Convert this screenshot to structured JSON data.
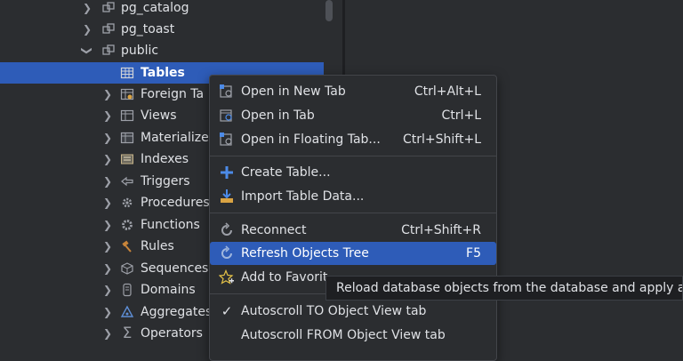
{
  "tree": {
    "items": [
      {
        "label": "pg_catalog",
        "icon": "schema-icon",
        "expanded": false
      },
      {
        "label": "pg_toast",
        "icon": "schema-icon",
        "expanded": false
      },
      {
        "label": "public",
        "icon": "schema-icon",
        "expanded": true
      },
      {
        "label": "Tables",
        "icon": "table-icon",
        "selected": true
      },
      {
        "label": "Foreign Ta",
        "icon": "foreign-table-icon"
      },
      {
        "label": "Views",
        "icon": "view-icon"
      },
      {
        "label": "Materialize",
        "icon": "materialized-view-icon"
      },
      {
        "label": "Indexes",
        "icon": "index-icon"
      },
      {
        "label": "Triggers",
        "icon": "trigger-icon"
      },
      {
        "label": "Procedures",
        "icon": "procedure-icon"
      },
      {
        "label": "Functions",
        "icon": "function-icon"
      },
      {
        "label": "Rules",
        "icon": "rule-icon"
      },
      {
        "label": "Sequences",
        "icon": "sequence-icon"
      },
      {
        "label": "Domains",
        "icon": "domain-icon"
      },
      {
        "label": "Aggregates",
        "icon": "aggregate-icon"
      },
      {
        "label": "Operators",
        "icon": "operator-icon"
      }
    ]
  },
  "menu": {
    "items": [
      {
        "label": "Open in New Tab",
        "shortcut": "Ctrl+Alt+L",
        "icon": "open-new-tab-icon"
      },
      {
        "label": "Open in Tab",
        "shortcut": "Ctrl+L",
        "icon": "open-tab-icon"
      },
      {
        "label": "Open in Floating Tab...",
        "shortcut": "Ctrl+Shift+L",
        "icon": "open-floating-tab-icon"
      },
      {
        "label": "Create Table...",
        "shortcut": "",
        "icon": "plus-icon"
      },
      {
        "label": "Import Table Data...",
        "shortcut": "",
        "icon": "import-icon"
      },
      {
        "label": "Reconnect",
        "shortcut": "Ctrl+Shift+R",
        "icon": "reconnect-icon"
      },
      {
        "label": "Refresh Objects Tree",
        "shortcut": "F5",
        "icon": "refresh-icon",
        "highlighted": true
      },
      {
        "label": "Add to Favorit",
        "shortcut": "",
        "icon": "add-favorite-icon"
      },
      {
        "label": "Autoscroll TO Object View tab",
        "shortcut": "",
        "icon": "check-icon",
        "checked": true
      },
      {
        "label": "Autoscroll FROM Object View tab",
        "shortcut": "",
        "icon": "",
        "checked": false
      }
    ]
  },
  "tooltip": {
    "text": "Reload database objects from the database and apply any"
  },
  "colors": {
    "selection": "#2e5cb8",
    "background": "#2b2d30",
    "text": "#dfe1e5"
  }
}
